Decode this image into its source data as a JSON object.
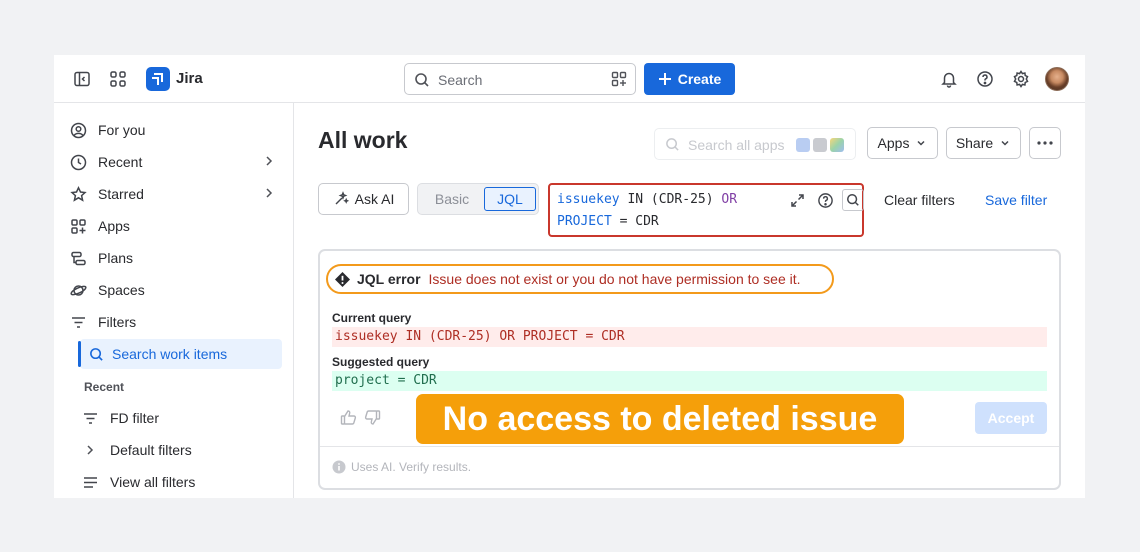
{
  "header": {
    "brand": "Jira",
    "search_placeholder": "Search",
    "create_label": "Create"
  },
  "sidebar": {
    "items": [
      {
        "label": "For you"
      },
      {
        "label": "Recent"
      },
      {
        "label": "Starred"
      },
      {
        "label": "Apps"
      },
      {
        "label": "Plans"
      },
      {
        "label": "Spaces"
      },
      {
        "label": "Filters"
      }
    ],
    "active_item": "Search work items",
    "section_label": "Recent",
    "recent_items": [
      {
        "label": "FD filter"
      },
      {
        "label": "Default filters"
      },
      {
        "label": "View all filters"
      }
    ]
  },
  "main": {
    "title": "All work",
    "apps_search_placeholder": "Search all apps",
    "apps_label": "Apps",
    "share_label": "Share",
    "ask_ai_label": "Ask AI",
    "mode_basic": "Basic",
    "mode_jql": "JQL",
    "jql": {
      "t1": "issuekey",
      "t2": " IN (CDR-25) ",
      "t3": "OR",
      "t4": "PROJECT",
      "t5": " = CDR"
    },
    "clear_filters": "Clear filters",
    "save_filter": "Save filter"
  },
  "ai_panel": {
    "error_title": "JQL error",
    "error_message": "Issue does not exist or you do not have permission to see it.",
    "current_label": "Current query",
    "current_query": "issuekey IN (CDR-25) OR PROJECT = CDR",
    "suggested_label": "Suggested query",
    "suggested_query": "project = CDR",
    "accept_label": "Accept",
    "footer_note": "Uses AI. Verify results."
  },
  "overlay": {
    "caption": "No access to deleted issue"
  },
  "colors": {
    "brand_blue": "#1868db",
    "error_red": "#c9372c",
    "highlight_orange": "#f59f0a",
    "suggest_green": "#dcfff1"
  }
}
